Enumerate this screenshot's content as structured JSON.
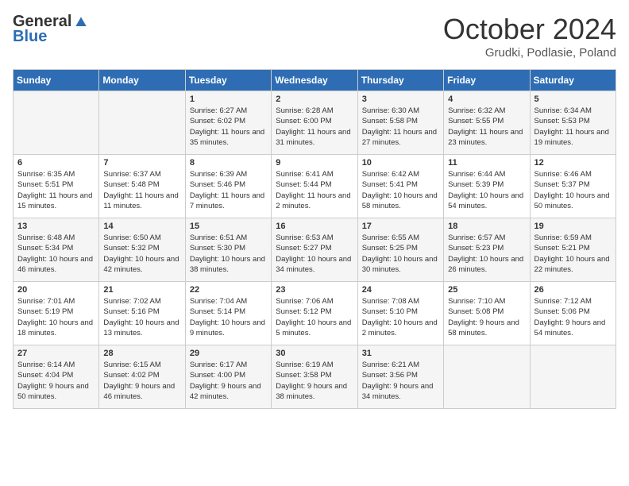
{
  "logo": {
    "general": "General",
    "blue": "Blue"
  },
  "title": "October 2024",
  "location": "Grudki, Podlasie, Poland",
  "weekdays": [
    "Sunday",
    "Monday",
    "Tuesday",
    "Wednesday",
    "Thursday",
    "Friday",
    "Saturday"
  ],
  "weeks": [
    [
      {
        "day": "",
        "info": ""
      },
      {
        "day": "",
        "info": ""
      },
      {
        "day": "1",
        "info": "Sunrise: 6:27 AM\nSunset: 6:02 PM\nDaylight: 11 hours and 35 minutes."
      },
      {
        "day": "2",
        "info": "Sunrise: 6:28 AM\nSunset: 6:00 PM\nDaylight: 11 hours and 31 minutes."
      },
      {
        "day": "3",
        "info": "Sunrise: 6:30 AM\nSunset: 5:58 PM\nDaylight: 11 hours and 27 minutes."
      },
      {
        "day": "4",
        "info": "Sunrise: 6:32 AM\nSunset: 5:55 PM\nDaylight: 11 hours and 23 minutes."
      },
      {
        "day": "5",
        "info": "Sunrise: 6:34 AM\nSunset: 5:53 PM\nDaylight: 11 hours and 19 minutes."
      }
    ],
    [
      {
        "day": "6",
        "info": "Sunrise: 6:35 AM\nSunset: 5:51 PM\nDaylight: 11 hours and 15 minutes."
      },
      {
        "day": "7",
        "info": "Sunrise: 6:37 AM\nSunset: 5:48 PM\nDaylight: 11 hours and 11 minutes."
      },
      {
        "day": "8",
        "info": "Sunrise: 6:39 AM\nSunset: 5:46 PM\nDaylight: 11 hours and 7 minutes."
      },
      {
        "day": "9",
        "info": "Sunrise: 6:41 AM\nSunset: 5:44 PM\nDaylight: 11 hours and 2 minutes."
      },
      {
        "day": "10",
        "info": "Sunrise: 6:42 AM\nSunset: 5:41 PM\nDaylight: 10 hours and 58 minutes."
      },
      {
        "day": "11",
        "info": "Sunrise: 6:44 AM\nSunset: 5:39 PM\nDaylight: 10 hours and 54 minutes."
      },
      {
        "day": "12",
        "info": "Sunrise: 6:46 AM\nSunset: 5:37 PM\nDaylight: 10 hours and 50 minutes."
      }
    ],
    [
      {
        "day": "13",
        "info": "Sunrise: 6:48 AM\nSunset: 5:34 PM\nDaylight: 10 hours and 46 minutes."
      },
      {
        "day": "14",
        "info": "Sunrise: 6:50 AM\nSunset: 5:32 PM\nDaylight: 10 hours and 42 minutes."
      },
      {
        "day": "15",
        "info": "Sunrise: 6:51 AM\nSunset: 5:30 PM\nDaylight: 10 hours and 38 minutes."
      },
      {
        "day": "16",
        "info": "Sunrise: 6:53 AM\nSunset: 5:27 PM\nDaylight: 10 hours and 34 minutes."
      },
      {
        "day": "17",
        "info": "Sunrise: 6:55 AM\nSunset: 5:25 PM\nDaylight: 10 hours and 30 minutes."
      },
      {
        "day": "18",
        "info": "Sunrise: 6:57 AM\nSunset: 5:23 PM\nDaylight: 10 hours and 26 minutes."
      },
      {
        "day": "19",
        "info": "Sunrise: 6:59 AM\nSunset: 5:21 PM\nDaylight: 10 hours and 22 minutes."
      }
    ],
    [
      {
        "day": "20",
        "info": "Sunrise: 7:01 AM\nSunset: 5:19 PM\nDaylight: 10 hours and 18 minutes."
      },
      {
        "day": "21",
        "info": "Sunrise: 7:02 AM\nSunset: 5:16 PM\nDaylight: 10 hours and 13 minutes."
      },
      {
        "day": "22",
        "info": "Sunrise: 7:04 AM\nSunset: 5:14 PM\nDaylight: 10 hours and 9 minutes."
      },
      {
        "day": "23",
        "info": "Sunrise: 7:06 AM\nSunset: 5:12 PM\nDaylight: 10 hours and 5 minutes."
      },
      {
        "day": "24",
        "info": "Sunrise: 7:08 AM\nSunset: 5:10 PM\nDaylight: 10 hours and 2 minutes."
      },
      {
        "day": "25",
        "info": "Sunrise: 7:10 AM\nSunset: 5:08 PM\nDaylight: 9 hours and 58 minutes."
      },
      {
        "day": "26",
        "info": "Sunrise: 7:12 AM\nSunset: 5:06 PM\nDaylight: 9 hours and 54 minutes."
      }
    ],
    [
      {
        "day": "27",
        "info": "Sunrise: 6:14 AM\nSunset: 4:04 PM\nDaylight: 9 hours and 50 minutes."
      },
      {
        "day": "28",
        "info": "Sunrise: 6:15 AM\nSunset: 4:02 PM\nDaylight: 9 hours and 46 minutes."
      },
      {
        "day": "29",
        "info": "Sunrise: 6:17 AM\nSunset: 4:00 PM\nDaylight: 9 hours and 42 minutes."
      },
      {
        "day": "30",
        "info": "Sunrise: 6:19 AM\nSunset: 3:58 PM\nDaylight: 9 hours and 38 minutes."
      },
      {
        "day": "31",
        "info": "Sunrise: 6:21 AM\nSunset: 3:56 PM\nDaylight: 9 hours and 34 minutes."
      },
      {
        "day": "",
        "info": ""
      },
      {
        "day": "",
        "info": ""
      }
    ]
  ]
}
